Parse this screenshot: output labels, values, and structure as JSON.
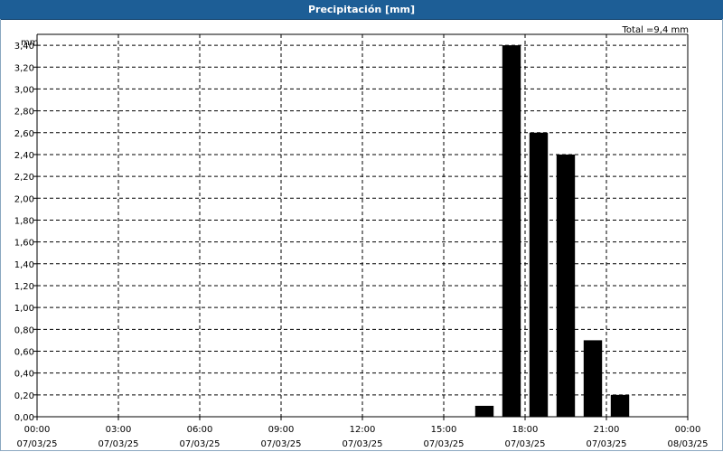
{
  "window": {
    "title": "Precipitación [mm]"
  },
  "colors": {
    "title_bar": "#1d5e96",
    "bars": "#000000",
    "grid": "#000000"
  },
  "chart_data": {
    "type": "bar",
    "title": "Precipitación [mm]",
    "ylabel": "mm",
    "xlabel": "",
    "total_label": "Total =9,4 mm",
    "ylim": [
      0,
      3.5
    ],
    "y_ticks": [
      "0,00",
      "0,20",
      "0,40",
      "0,60",
      "0,80",
      "1,00",
      "1,20",
      "1,40",
      "1,60",
      "1,80",
      "2,00",
      "2,20",
      "2,40",
      "2,60",
      "2,80",
      "3,00",
      "3,20",
      "3,40"
    ],
    "x_range_hours": [
      0,
      24
    ],
    "x_ticks": [
      {
        "time": "00:00",
        "date": "07/03/25"
      },
      {
        "time": "03:00",
        "date": "07/03/25"
      },
      {
        "time": "06:00",
        "date": "07/03/25"
      },
      {
        "time": "09:00",
        "date": "07/03/25"
      },
      {
        "time": "12:00",
        "date": "07/03/25"
      },
      {
        "time": "15:00",
        "date": "07/03/25"
      },
      {
        "time": "18:00",
        "date": "07/03/25"
      },
      {
        "time": "21:00",
        "date": "07/03/25"
      },
      {
        "time": "00:00",
        "date": "08/03/25"
      }
    ],
    "grid": true,
    "bars": [
      {
        "time": "16:30",
        "value": 0.1
      },
      {
        "time": "17:30",
        "value": 3.4
      },
      {
        "time": "18:30",
        "value": 2.6
      },
      {
        "time": "19:30",
        "value": 2.4
      },
      {
        "time": "20:30",
        "value": 0.7
      },
      {
        "time": "21:30",
        "value": 0.2
      }
    ]
  }
}
